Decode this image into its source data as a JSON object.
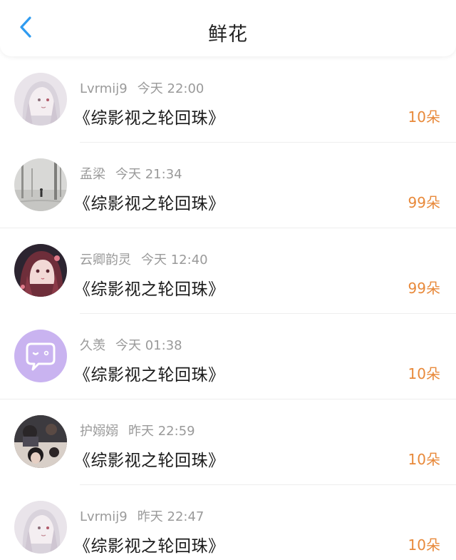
{
  "header": {
    "title": "鲜花",
    "back_icon": "chevron-left-icon",
    "accent": "#2f9bf0"
  },
  "colors": {
    "count": "#e8893a",
    "meta": "#9a9a9a"
  },
  "items": [
    {
      "user": "Lvrmij9",
      "time": "今天 22:00",
      "book": "《综影视之轮回珠》",
      "count": "10朵",
      "avatar": "anime-girl-silver-hair"
    },
    {
      "user": "孟梁",
      "time": "今天 21:34",
      "book": "《综影视之轮回珠》",
      "count": "99朵",
      "avatar": "misty-landscape-figure"
    },
    {
      "user": "云卿韵灵",
      "time": "今天 12:40",
      "book": "《综影视之轮回珠》",
      "count": "99朵",
      "avatar": "anime-girl-red-hair"
    },
    {
      "user": "久羡",
      "time": "今天 01:38",
      "book": "《综影视之轮回珠》",
      "count": "10朵",
      "avatar": "purple-chat-bubble"
    },
    {
      "user": "护嫋嫋",
      "time": "昨天 22:59",
      "book": "《综影视之轮回珠》",
      "count": "10朵",
      "avatar": "photo-people"
    },
    {
      "user": "Lvrmij9",
      "time": "昨天 22:47",
      "book": "《综影视之轮回珠》",
      "count": "10朵",
      "avatar": "anime-girl-silver-hair"
    }
  ]
}
